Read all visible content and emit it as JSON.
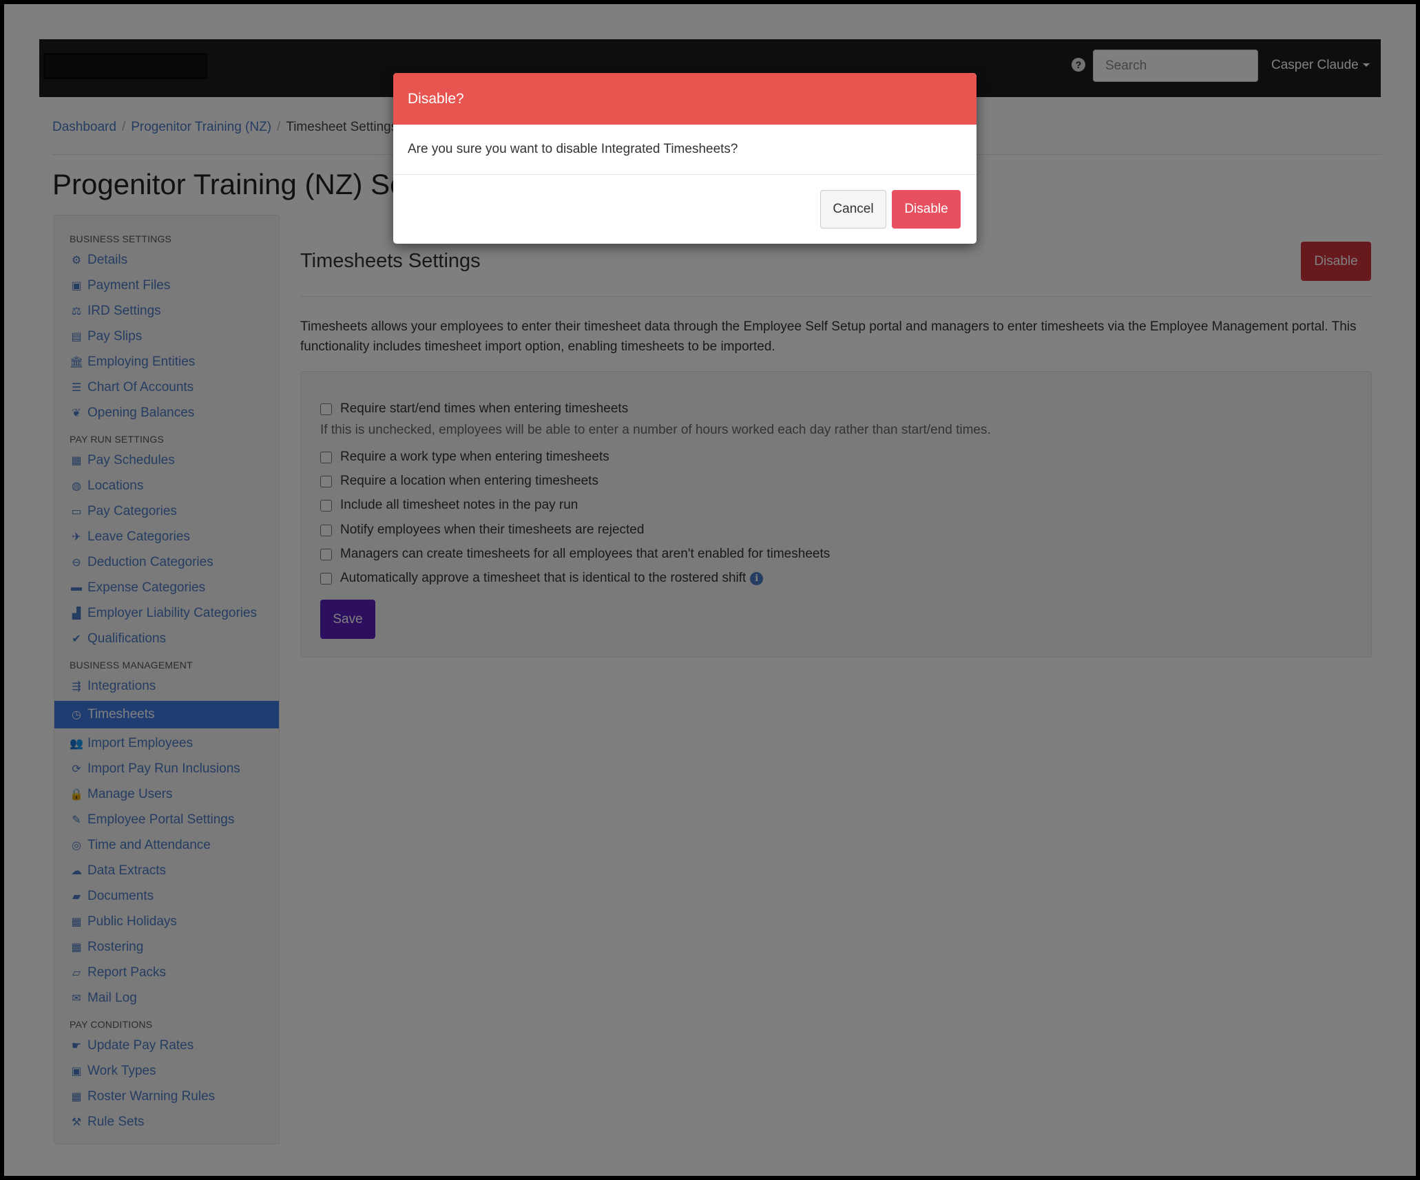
{
  "topbar": {
    "search_placeholder": "Search",
    "user_name": "Casper Claude",
    "help_glyph": "?"
  },
  "breadcrumb": [
    "Dashboard",
    "Progenitor Training (NZ)",
    "Timesheet Settings"
  ],
  "page_title": "Progenitor Training (NZ) Settings",
  "sidebar": {
    "sections": [
      {
        "heading": "BUSINESS SETTINGS",
        "items": [
          {
            "label": "Details",
            "icon": "gear-icon",
            "glyph": "⚙"
          },
          {
            "label": "Payment Files",
            "icon": "floppy-icon",
            "glyph": "▣"
          },
          {
            "label": "IRD Settings",
            "icon": "scale-icon",
            "glyph": "⚖"
          },
          {
            "label": "Pay Slips",
            "icon": "file-icon",
            "glyph": "▤"
          },
          {
            "label": "Employing Entities",
            "icon": "bank-icon",
            "glyph": "🏛"
          },
          {
            "label": "Chart Of Accounts",
            "icon": "list-icon",
            "glyph": "☰"
          },
          {
            "label": "Opening Balances",
            "icon": "leaf-icon",
            "glyph": "❦"
          }
        ]
      },
      {
        "heading": "PAY RUN SETTINGS",
        "items": [
          {
            "label": "Pay Schedules",
            "icon": "calendar-icon",
            "glyph": "▦"
          },
          {
            "label": "Locations",
            "icon": "globe-icon",
            "glyph": "◍"
          },
          {
            "label": "Pay Categories",
            "icon": "money-icon",
            "glyph": "▭"
          },
          {
            "label": "Leave Categories",
            "icon": "plane-icon",
            "glyph": "✈"
          },
          {
            "label": "Deduction Categories",
            "icon": "minus-circle-icon",
            "glyph": "⊖"
          },
          {
            "label": "Expense Categories",
            "icon": "archive-icon",
            "glyph": "▬"
          },
          {
            "label": "Employer Liability Categories",
            "icon": "bar-chart-icon",
            "glyph": "▟"
          },
          {
            "label": "Qualifications",
            "icon": "check-icon",
            "glyph": "✔"
          }
        ]
      },
      {
        "heading": "BUSINESS MANAGEMENT",
        "items": [
          {
            "label": "Integrations",
            "icon": "integration-icon",
            "glyph": "⇶"
          },
          {
            "label": "Timesheets",
            "icon": "clock-icon",
            "glyph": "◷",
            "active": true
          },
          {
            "label": "Import Employees",
            "icon": "users-icon",
            "glyph": "👥"
          },
          {
            "label": "Import Pay Run Inclusions",
            "icon": "refresh-icon",
            "glyph": "⟳"
          },
          {
            "label": "Manage Users",
            "icon": "lock-icon",
            "glyph": "🔒"
          },
          {
            "label": "Employee Portal Settings",
            "icon": "wand-icon",
            "glyph": "✎"
          },
          {
            "label": "Time and Attendance",
            "icon": "life-ring-icon",
            "glyph": "◎"
          },
          {
            "label": "Data Extracts",
            "icon": "cloud-download-icon",
            "glyph": "☁"
          },
          {
            "label": "Documents",
            "icon": "folder-icon",
            "glyph": "▰"
          },
          {
            "label": "Public Holidays",
            "icon": "calendar-icon",
            "glyph": "▦"
          },
          {
            "label": "Rostering",
            "icon": "calendar-icon",
            "glyph": "▦"
          },
          {
            "label": "Report Packs",
            "icon": "folder-open-icon",
            "glyph": "▱"
          },
          {
            "label": "Mail Log",
            "icon": "envelope-icon",
            "glyph": "✉"
          }
        ]
      },
      {
        "heading": "PAY CONDITIONS",
        "items": [
          {
            "label": "Update Pay Rates",
            "icon": "hand-money-icon",
            "glyph": "☛"
          },
          {
            "label": "Work Types",
            "icon": "camera-icon",
            "glyph": "▣"
          },
          {
            "label": "Roster Warning Rules",
            "icon": "calendar-icon",
            "glyph": "▦"
          },
          {
            "label": "Rule Sets",
            "icon": "gavel-icon",
            "glyph": "⚒"
          }
        ]
      }
    ]
  },
  "main": {
    "section_title": "Timesheets Settings",
    "disable_label": "Disable",
    "description": "Timesheets allows your employees to enter their timesheet data through the Employee Self Setup portal and managers to enter timesheets via the Employee Management portal. This functionality includes timesheet import option, enabling timesheets to be imported.",
    "options": [
      {
        "label": "Require start/end times when entering timesheets",
        "checked": false
      },
      {
        "label": "Require a work type when entering timesheets",
        "checked": false
      },
      {
        "label": "Require a location when entering timesheets",
        "checked": false
      },
      {
        "label": "Include all timesheet notes in the pay run",
        "checked": false
      },
      {
        "label": "Notify employees when their timesheets are rejected",
        "checked": false
      },
      {
        "label": "Managers can create timesheets for all employees that aren't enabled for timesheets",
        "checked": false
      },
      {
        "label": "Automatically approve a timesheet that is identical to the rostered shift",
        "checked": false
      }
    ],
    "help_text": "If this is unchecked, employees will be able to enter a number of hours worked each day rather than start/end times.",
    "info_glyph": "i",
    "save_label": "Save"
  },
  "modal": {
    "title": "Disable?",
    "message": "Are you sure you want to disable Integrated Timesheets?",
    "cancel_label": "Cancel",
    "confirm_label": "Disable"
  },
  "colors": {
    "topbar": "#1c1c1e",
    "link": "#4a7ac4",
    "active_item": "#3f7be0",
    "danger": "#d1323d",
    "modal_header": "#e8544f",
    "modal_confirm": "#e9505f",
    "save": "#5a1ec0"
  }
}
